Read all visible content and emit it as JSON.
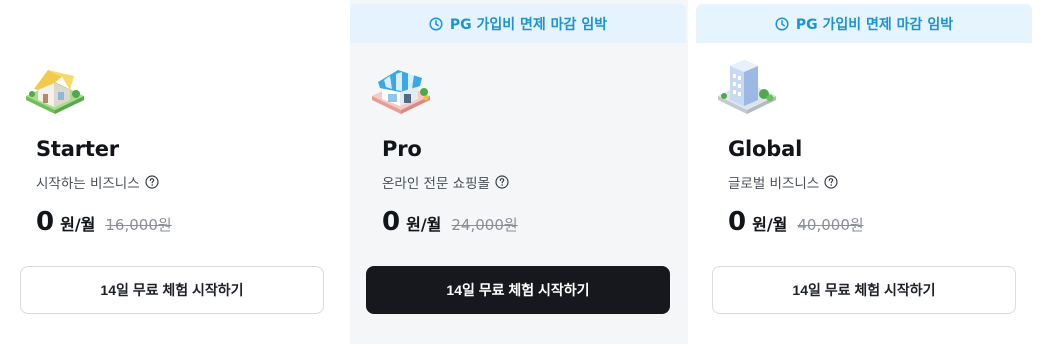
{
  "plans": [
    {
      "promo": "",
      "name": "Starter",
      "desc": "시작하는 비즈니스",
      "price": "0",
      "unit": "원/월",
      "original": "16,000원",
      "cta": "14일 무료 체험 시작하기",
      "illustration": "house-icon"
    },
    {
      "promo": "PG 가입비 면제 마감 임박",
      "name": "Pro",
      "desc": "온라인 전문 쇼핑몰",
      "price": "0",
      "unit": "원/월",
      "original": "24,000원",
      "cta": "14일 무료 체험 시작하기",
      "illustration": "store-icon"
    },
    {
      "promo": "PG 가입비 면제 마감 임박",
      "name": "Global",
      "desc": "글로벌 비즈니스",
      "price": "0",
      "unit": "원/월",
      "original": "40,000원",
      "cta": "14일 무료 체험 시작하기",
      "illustration": "building-icon"
    }
  ],
  "colors": {
    "promo_text": "#1b93d4",
    "promo_bg": "#e4f3fd",
    "highlight_bg": "#f5f6f8",
    "cta_dark": "#16181d"
  }
}
